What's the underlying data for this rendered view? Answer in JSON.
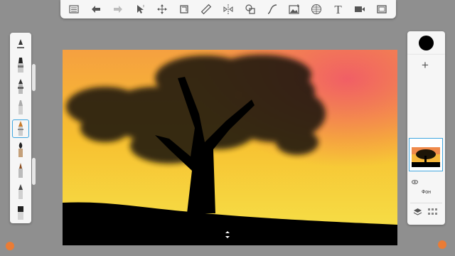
{
  "toolbar": {
    "items": [
      {
        "icon": "gallery-icon"
      },
      {
        "icon": "undo-icon"
      },
      {
        "icon": "redo-icon"
      },
      {
        "icon": "select-icon"
      },
      {
        "icon": "transform-icon"
      },
      {
        "icon": "canvas-resize-icon"
      },
      {
        "icon": "ruler-icon"
      },
      {
        "icon": "symmetry-icon"
      },
      {
        "icon": "shapes-icon"
      },
      {
        "icon": "curve-icon"
      },
      {
        "icon": "image-icon"
      },
      {
        "icon": "perspective-icon"
      },
      {
        "icon": "text-icon",
        "text": "T"
      },
      {
        "icon": "video-icon"
      },
      {
        "icon": "fullscreen-icon"
      }
    ]
  },
  "brushes": [
    {
      "icon": "brush-size-icon"
    },
    {
      "icon": "airbrush-icon"
    },
    {
      "icon": "pencil-icon"
    },
    {
      "icon": "marker-icon"
    },
    {
      "icon": "pen-icon",
      "selected": true
    },
    {
      "icon": "paintbrush-icon"
    },
    {
      "icon": "ink-pen-icon"
    },
    {
      "icon": "fine-pen-icon"
    },
    {
      "icon": "eraser-icon"
    }
  ],
  "color_panel": {
    "current_color": "#000000"
  },
  "layers_panel": {
    "add_label": "+",
    "background_layer_label": "Фон"
  },
  "colors": {
    "accent": "#3ea6df",
    "sky_top": "#f05a52",
    "sky_bottom": "#f5e040",
    "ground": "#000000"
  }
}
